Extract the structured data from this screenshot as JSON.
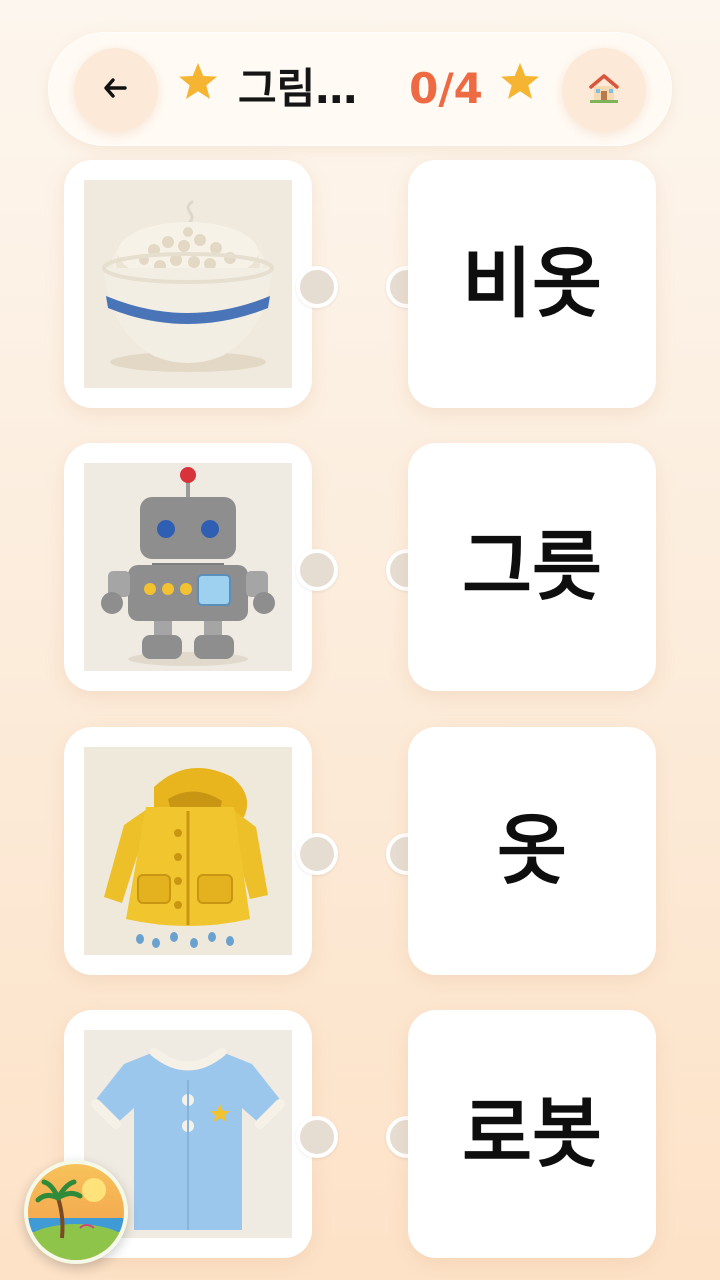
{
  "header": {
    "title": "그림…",
    "score": "0/4",
    "back_icon": "arrow-left-icon",
    "home_icon": "house-icon",
    "star_icon": "star-icon",
    "star_color": "#f5b431",
    "score_color": "#ee6a43"
  },
  "images": [
    {
      "icon": "rice-bowl-icon"
    },
    {
      "icon": "robot-icon"
    },
    {
      "icon": "raincoat-icon"
    },
    {
      "icon": "shirt-icon"
    }
  ],
  "words": [
    {
      "label": "비옷"
    },
    {
      "label": "그릇"
    },
    {
      "label": "옷"
    },
    {
      "label": "로봇"
    }
  ],
  "badge": {
    "icon": "island-logo-icon"
  }
}
